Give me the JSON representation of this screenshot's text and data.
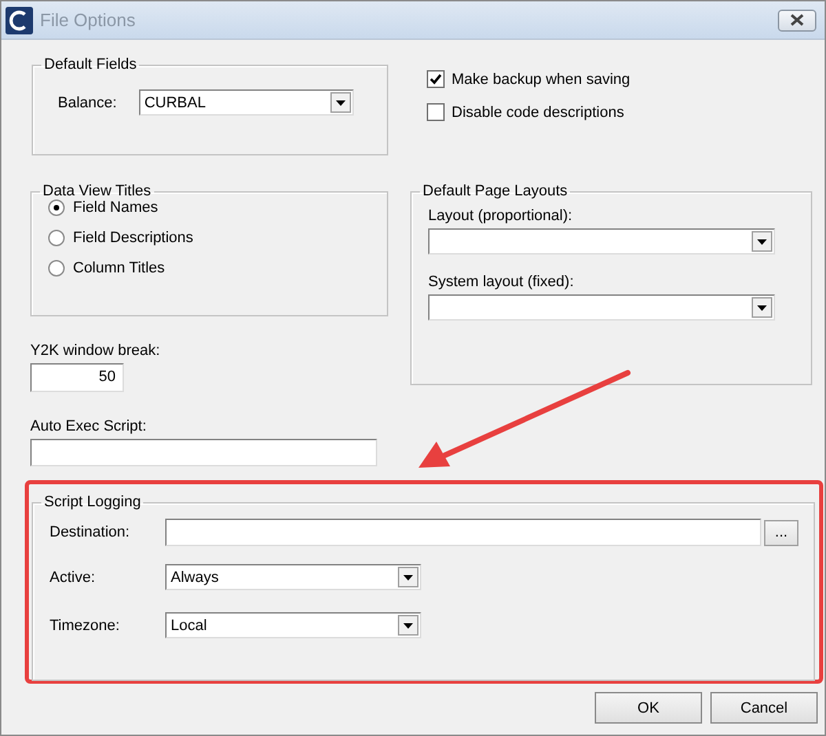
{
  "window": {
    "title": "File Options"
  },
  "default_fields": {
    "title": "Default Fields",
    "balance": {
      "label": "Balance:",
      "value": "CURBAL"
    }
  },
  "options": [
    {
      "label": "Make backup when saving",
      "checked": true
    },
    {
      "label": "Disable code descriptions",
      "checked": false
    }
  ],
  "data_view_titles": {
    "title": "Data View Titles",
    "options": [
      {
        "label": "Field Names",
        "selected": true
      },
      {
        "label": "Field Descriptions",
        "selected": false
      },
      {
        "label": "Column Titles",
        "selected": false
      }
    ]
  },
  "default_page_layouts": {
    "title": "Default Page Layouts",
    "fields": [
      {
        "label": "Layout (proportional):"
      },
      {
        "label": "System layout (fixed):"
      }
    ]
  },
  "y2k_window_break": {
    "label": "Y2K window break:",
    "value": "50"
  },
  "auto_exec_script": {
    "label": "Auto Exec Script:"
  },
  "script_logging": {
    "title": "Script Logging",
    "highlighted": true,
    "destination": {
      "label": "Destination:",
      "browse": "..."
    },
    "active": {
      "label": "Active:",
      "value": "Always"
    },
    "timezone": {
      "label": "Timezone:",
      "value": "Local"
    }
  },
  "buttons": [
    {
      "label": "OK"
    },
    {
      "label": "Cancel"
    }
  ]
}
